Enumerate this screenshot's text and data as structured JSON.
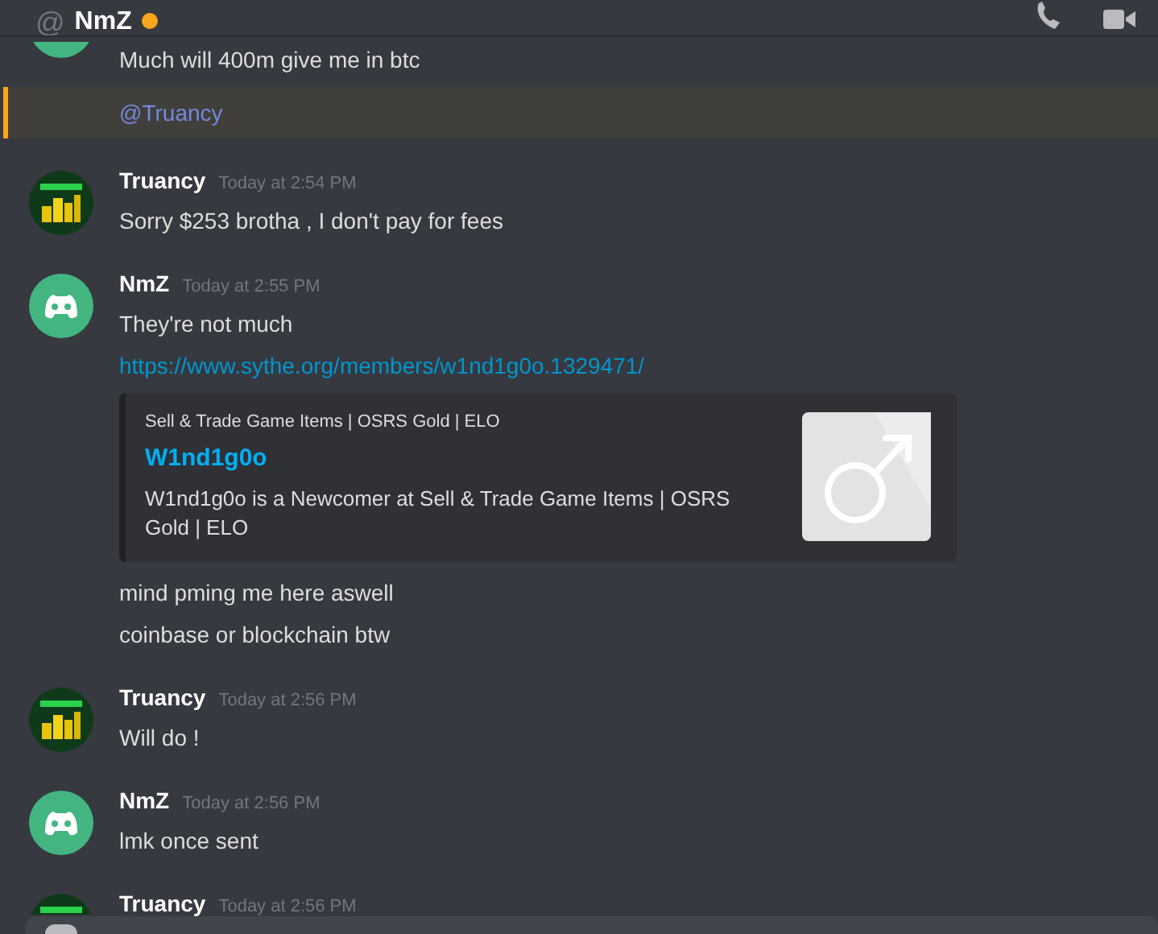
{
  "header": {
    "icon": "@",
    "title": "NmZ",
    "status": {
      "kind": "idle"
    }
  },
  "messages": [
    {
      "kind": "continuation",
      "avatar": {
        "kind": "discord"
      },
      "lines": [
        {
          "kind": "text",
          "text": "Much will 400m give me in btc",
          "highlighted": false
        },
        {
          "kind": "mention",
          "text": "@Truancy",
          "highlighted": true
        }
      ]
    },
    {
      "kind": "group",
      "avatar": {
        "kind": "coins"
      },
      "author": "Truancy",
      "timestamp": "Today at 2:54 PM",
      "lines": [
        {
          "kind": "text",
          "text": "Sorry $253 brotha , I don't pay for fees",
          "highlighted": false
        }
      ]
    },
    {
      "kind": "group",
      "avatar": {
        "kind": "discord"
      },
      "author": "NmZ",
      "timestamp": "Today at 2:55 PM",
      "lines": [
        {
          "kind": "text",
          "text": "They're not much",
          "highlighted": false
        },
        {
          "kind": "link",
          "text": "https://www.sythe.org/members/w1nd1g0o.1329471/",
          "highlighted": false
        },
        {
          "kind": "embed",
          "provider": "Sell & Trade Game Items | OSRS Gold | ELO",
          "title": "W1nd1g0o",
          "description": "W1nd1g0o is a Newcomer at Sell & Trade Game Items | OSRS Gold | ELO",
          "highlighted": false
        },
        {
          "kind": "text",
          "text": "mind pming me here aswell",
          "highlighted": false
        },
        {
          "kind": "text",
          "text": "coinbase or blockchain btw",
          "highlighted": false
        }
      ]
    },
    {
      "kind": "group",
      "avatar": {
        "kind": "coins"
      },
      "author": "Truancy",
      "timestamp": "Today at 2:56 PM",
      "lines": [
        {
          "kind": "text",
          "text": "Will do !",
          "highlighted": false
        }
      ]
    },
    {
      "kind": "group",
      "avatar": {
        "kind": "discord"
      },
      "author": "NmZ",
      "timestamp": "Today at 2:56 PM",
      "lines": [
        {
          "kind": "text",
          "text": "lmk once sent",
          "highlighted": false
        }
      ]
    },
    {
      "kind": "group",
      "avatar": {
        "kind": "coins"
      },
      "author": "Truancy",
      "timestamp": "Today at 2:56 PM"
    }
  ]
}
